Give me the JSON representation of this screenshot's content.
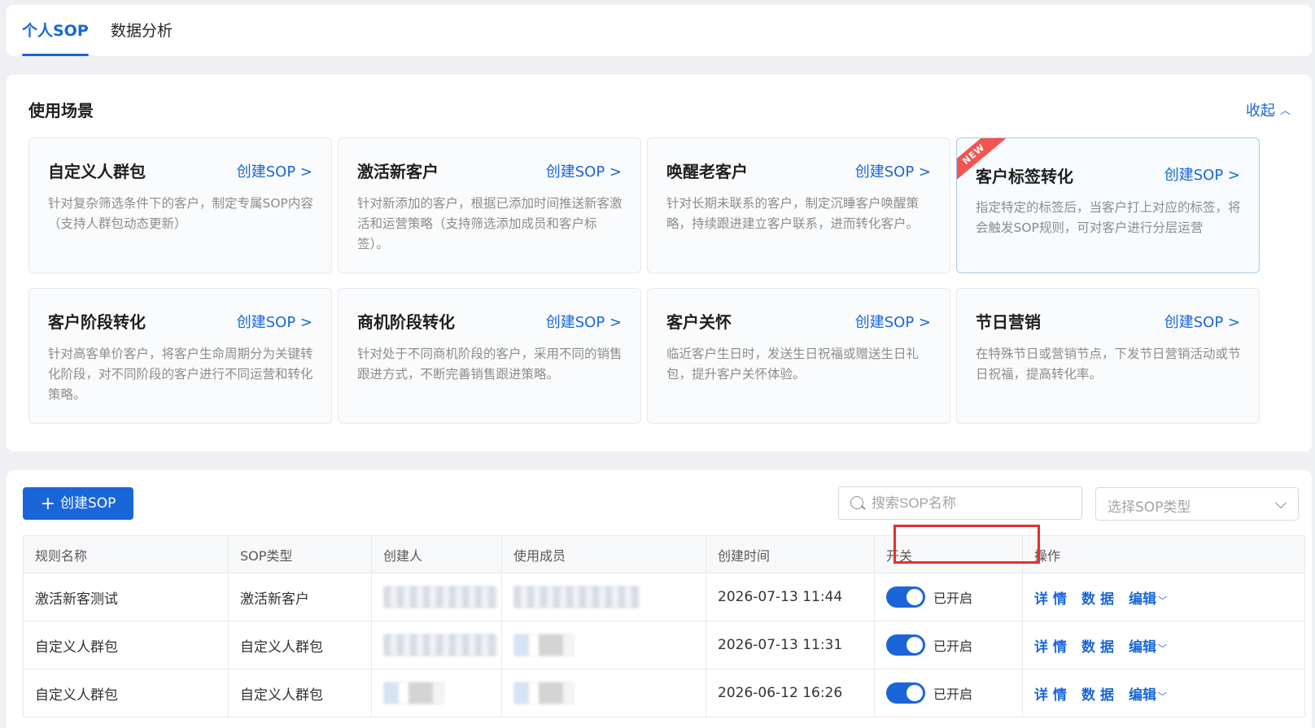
{
  "tabs": [
    {
      "label": "个人SOP"
    },
    {
      "label": "数据分析"
    }
  ],
  "scenarios": {
    "title": "使用场景",
    "collapse_label": "收起",
    "cards": [
      {
        "title": "自定义人群包",
        "link": "创建SOP >",
        "desc": "针对复杂筛选条件下的客户，制定专属SOP内容（支持人群包动态更新）"
      },
      {
        "title": "激活新客户",
        "link": "创建SOP >",
        "desc": "针对新添加的客户，根据已添加时间推送新客激活和运营策略（支持筛选添加成员和客户标签）。"
      },
      {
        "title": "唤醒老客户",
        "link": "创建SOP >",
        "desc": "针对长期未联系的客户，制定沉睡客户唤醒策略，持续跟进建立客户联系，进而转化客户。"
      },
      {
        "title": "客户标签转化",
        "link": "创建SOP >",
        "desc": "指定特定的标签后，当客户打上对应的标签，将会触发SOP规则，可对客户进行分层运营",
        "badge": "NEW"
      },
      {
        "title": "客户阶段转化",
        "link": "创建SOP >",
        "desc": "针对高客单价客户，将客户生命周期分为关键转化阶段，对不同阶段的客户进行不同运营和转化策略。"
      },
      {
        "title": "商机阶段转化",
        "link": "创建SOP >",
        "desc": "针对处于不同商机阶段的客户，采用不同的销售跟进方式，不断完善销售跟进策略。"
      },
      {
        "title": "客户关怀",
        "link": "创建SOP >",
        "desc": "临近客户生日时，发送生日祝福或赠送生日礼包，提升客户关怀体验。"
      },
      {
        "title": "节日营销",
        "link": "创建SOP >",
        "desc": "在特殊节日或营销节点，下发节日营销活动或节日祝福，提高转化率。"
      }
    ]
  },
  "list": {
    "create_label": "创建SOP",
    "search_placeholder": "搜索SOP名称",
    "type_placeholder": "选择SOP类型",
    "columns": [
      "规则名称",
      "SOP类型",
      "创建人",
      "使用成员",
      "创建时间",
      "开关",
      "操作"
    ],
    "rows": [
      {
        "name": "激活新客测试",
        "type": "激活新客户",
        "created": "2026-07-13 11:44",
        "status": "已开启"
      },
      {
        "name": "自定义人群包",
        "type": "自定义人群包",
        "created": "2026-07-13 11:31",
        "status": "已开启"
      },
      {
        "name": "自定义人群包",
        "type": "自定义人群包",
        "created": "2026-06-12 16:26",
        "status": "已开启"
      }
    ],
    "actions": {
      "detail": "详情",
      "data": "数据",
      "edit": "编辑"
    }
  },
  "colors": {
    "accent": "#1a66d9",
    "highlight_box": "#e62e2e",
    "new_badge": "#f2554f"
  },
  "icons": [
    "plus-icon",
    "search-icon",
    "chevron-down-icon",
    "chevron-up-icon"
  ]
}
